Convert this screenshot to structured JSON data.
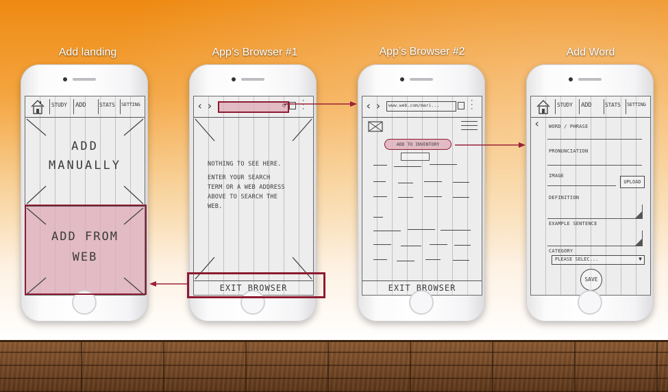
{
  "screens": [
    {
      "title": "Add landing",
      "tabs": [
        "STUDY",
        "ADD",
        "STATS",
        "SETTING"
      ],
      "add_manually": [
        "ADD",
        "MANUALLY"
      ],
      "add_from_web": [
        "ADD FROM",
        "WEB"
      ]
    },
    {
      "title": "App’s Browser #1",
      "message": [
        "NOTHING TO SEE HERE.",
        "ENTER YOUR SEARCH",
        "TERM OR A WEB ADDRESS",
        "ABOVE TO SEARCH THE",
        "WEB."
      ],
      "exit_label": "EXIT  BROWSER"
    },
    {
      "title": "App’s Browser #2",
      "url": "www.web.com/mari...",
      "add_inventory_label": "ADD TO INVENTORY",
      "exit_label": "EXIT  BROWSER"
    },
    {
      "title": "Add Word",
      "tabs": [
        "STUDY",
        "ADD",
        "STATS",
        "SETTING"
      ],
      "fields": {
        "word": "WORD / PHRASE",
        "pronunciation": "PRONUNCIATION",
        "image": "IMAGE",
        "upload": "UPLOAD",
        "definition": "DEFINITION",
        "example": "EXAMPLE SENTENCE",
        "category": "CATEGORY",
        "category_placeholder": "PLEASE SELEC...",
        "save": "SAVE"
      }
    }
  ],
  "colors": {
    "highlight": "#deaab6",
    "arrow": "#9a2038",
    "frame": "#8b1a2f"
  }
}
